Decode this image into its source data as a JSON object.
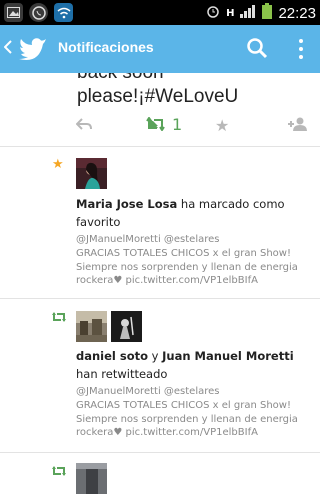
{
  "statusbar": {
    "time": "22:23",
    "network": "H"
  },
  "appbar": {
    "title": "Notificaciones"
  },
  "top_tweet": {
    "line1": "back soon",
    "line2": "please!¡#WeLoveU",
    "retweet_count": "1"
  },
  "notifications": [
    {
      "type": "favorite",
      "actor1": "Maria Jose Losa",
      "action": "ha marcado como favorito",
      "quote": [
        "@JManuelMoretti @estelares",
        "GRACIAS TOTALES CHICOS x el gran Show!",
        "Siempre nos sorprenden y llenan de energia",
        "rockera♥ pic.twitter.com/VP1elbBIfA"
      ]
    },
    {
      "type": "retweet",
      "actor1": "daniel soto",
      "connector": "y",
      "actor2": "Juan Manuel Moretti",
      "action": "han retwitteado",
      "quote": [
        "@JManuelMoretti @estelares",
        "GRACIAS TOTALES CHICOS x el gran Show!",
        "Siempre nos sorprenden y llenan de energia",
        "rockera♥ pic.twitter.com/VP1elbBIfA"
      ]
    }
  ],
  "colors": {
    "appbar": "#5bb5e8",
    "retweet": "#5aa35a",
    "favorite": "#f5a623"
  }
}
